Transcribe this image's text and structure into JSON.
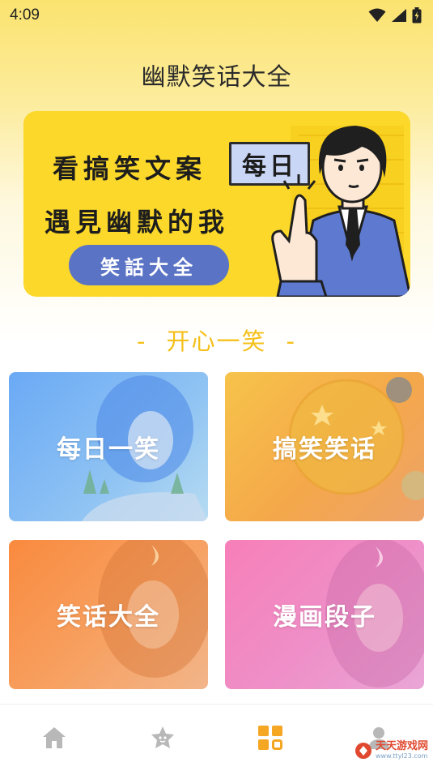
{
  "status_bar": {
    "time": "4:09"
  },
  "app": {
    "title": "幽默笑话大全"
  },
  "banner": {
    "line1": "看搞笑文案",
    "box_text": "每日",
    "line2": "遇見幽默的我",
    "pill_text": "笑話大全"
  },
  "section": {
    "left_dash": "-",
    "title": "开心一笑",
    "right_dash": "-"
  },
  "cards": [
    {
      "label": "每日一笑"
    },
    {
      "label": "搞笑笑话"
    },
    {
      "label": "笑话大全"
    },
    {
      "label": "漫画段子"
    }
  ],
  "bottom_nav": {
    "items": [
      {
        "icon": "home-icon",
        "active": false
      },
      {
        "icon": "star-face-icon",
        "active": false
      },
      {
        "icon": "grid-icon",
        "active": true
      },
      {
        "icon": "profile-icon",
        "active": false
      }
    ]
  },
  "watermark": {
    "text": "天天游戏网",
    "sub": "www.ttyl23.com"
  },
  "colors": {
    "accent": "#f5c01a",
    "active_nav": "#f5a623",
    "inactive_nav": "#b8b8b8"
  }
}
